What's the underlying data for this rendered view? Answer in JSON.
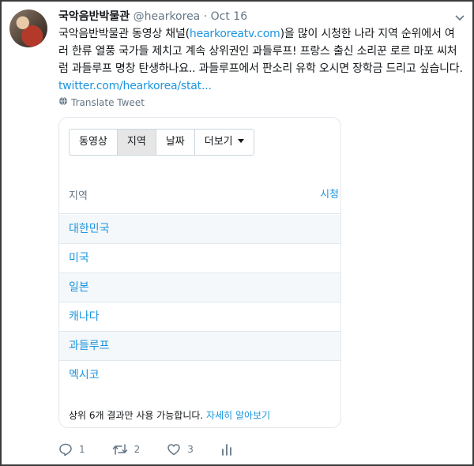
{
  "tweet": {
    "display_name": "국악음반박물관",
    "handle": "@hearkorea",
    "dot": "·",
    "date": "Oct 16",
    "text_part1": "국악음반박물관 동영상 채널(",
    "text_link1": "hearkoreatv.com",
    "text_part2": ")을 많이 시청한 나라 지역 순위에서 여러 한류 열풍 국가들 제치고 계속 상위권인 과들루프! 프랑스 출신 소리꾼 로르 마포 씨처럼 과들루프 명창 탄생하나요.. 과들루프에서 판소리 유학 오시면 장학금 드리고 싶습니다. ",
    "text_link2": "twitter.com/hearkorea/stat...",
    "translate_label": "Translate Tweet"
  },
  "card": {
    "tabs": [
      {
        "label": "동영상"
      },
      {
        "label": "지역"
      },
      {
        "label": "날짜"
      },
      {
        "label": "더보기"
      }
    ],
    "column_region": "지역",
    "column_views": "시청",
    "rows": [
      {
        "region": "대한민국"
      },
      {
        "region": "미국"
      },
      {
        "region": "일본"
      },
      {
        "region": "캐나다"
      },
      {
        "region": "과들루프"
      },
      {
        "region": "멕시코"
      }
    ],
    "footer_text": "상위 6개 결과만 사용 가능합니다. ",
    "footer_link": "자세히 알아보기"
  },
  "actions": {
    "reply_count": "1",
    "retweet_count": "2",
    "like_count": "3"
  },
  "icons": [
    "avatar",
    "chevron-down-icon",
    "globe-icon",
    "reply-icon",
    "retweet-icon",
    "heart-icon",
    "analytics-icon"
  ]
}
